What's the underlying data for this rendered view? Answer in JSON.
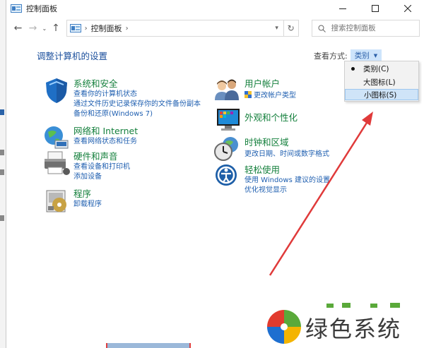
{
  "window": {
    "title": "控制面板"
  },
  "address": {
    "crumb": "控制面板"
  },
  "search": {
    "placeholder": "搜索控制面板"
  },
  "main": {
    "heading": "调整计算机的设置",
    "view_by_label": "查看方式:",
    "view_by_value": "类别"
  },
  "menu": {
    "items": [
      "类别(C)",
      "大图标(L)",
      "小图标(S)"
    ]
  },
  "categories": [
    {
      "title": "系统和安全",
      "links": [
        "查看你的计算机状态",
        "通过文件历史记录保存你的文件备份副本",
        "备份和还原(Windows 7)"
      ]
    },
    {
      "title": "网络和 Internet",
      "links": [
        "查看网络状态和任务"
      ]
    },
    {
      "title": "硬件和声音",
      "links": [
        "查看设备和打印机",
        "添加设备"
      ]
    },
    {
      "title": "程序",
      "links": [
        "卸载程序"
      ]
    },
    {
      "title": "用户帐户",
      "links": [
        "更改帐户类型"
      ]
    },
    {
      "title": "外观和个性化",
      "links": []
    },
    {
      "title": "时钟和区域",
      "links": [
        "更改日期、时间或数字格式"
      ]
    },
    {
      "title": "轻松使用",
      "links": [
        "使用 Windows 建议的设置",
        "优化视觉显示"
      ]
    }
  ],
  "watermark": {
    "text": "绿色系统"
  },
  "colors": {
    "link": "#1f5fb0",
    "category_title": "#15803d",
    "heading": "#1b4f9c",
    "arrow": "#e03a3a"
  }
}
